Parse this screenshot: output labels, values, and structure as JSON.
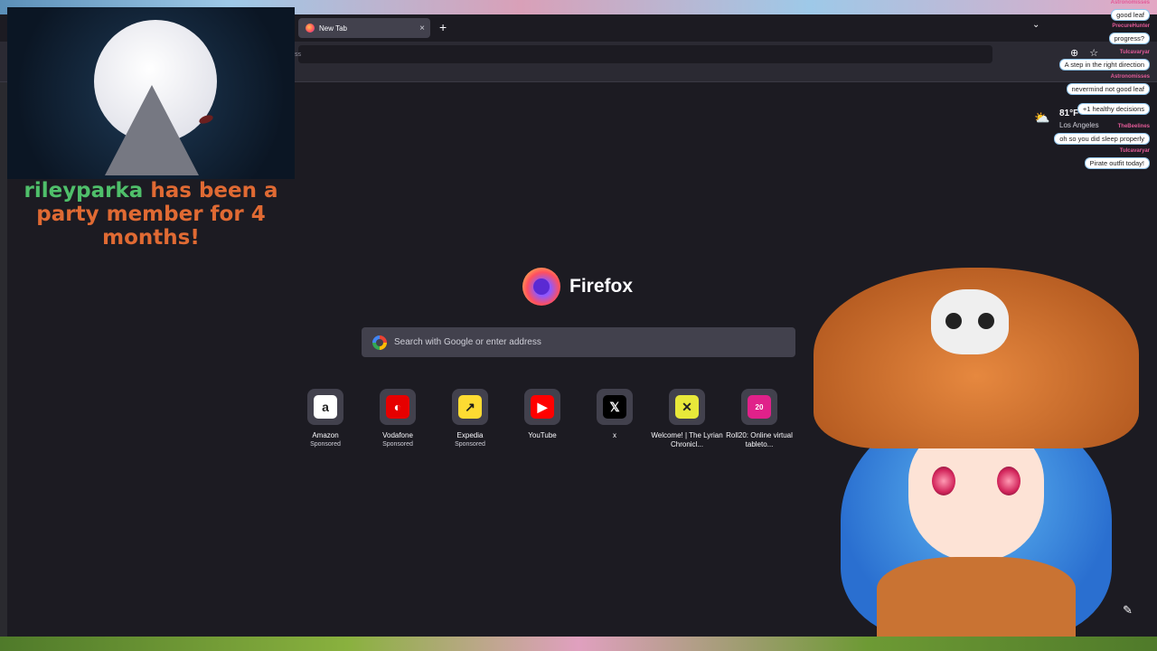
{
  "browser": {
    "tab": {
      "title": "New Tab"
    },
    "new_tab_symbol": "+",
    "tab_close_symbol": "×",
    "tab_list_symbol": "⌄",
    "urlbar_partial_text": "ss",
    "nav_icons": [
      "⊕",
      "☆"
    ]
  },
  "newtab": {
    "brand": "Firefox",
    "search_placeholder": "Search with Google or enter address",
    "tiles": [
      {
        "label": "Amazon",
        "sponsored": "Sponsored",
        "icon": "amazon-icon",
        "glyph": "a",
        "bg": "#ffffff",
        "fg": "#222222"
      },
      {
        "label": "Vodafone",
        "sponsored": "Sponsored",
        "icon": "vodafone-icon",
        "glyph": "◐",
        "bg": "#e60000",
        "fg": "#ffffff"
      },
      {
        "label": "Expedia",
        "sponsored": "Sponsored",
        "icon": "expedia-icon",
        "glyph": "↗",
        "bg": "#fddb32",
        "fg": "#1a1a1a"
      },
      {
        "label": "YouTube",
        "sponsored": "",
        "icon": "youtube-icon",
        "glyph": "▶",
        "bg": "#ff0000",
        "fg": "#ffffff"
      },
      {
        "label": "x",
        "sponsored": "",
        "icon": "x-icon",
        "glyph": "𝕏",
        "bg": "#000000",
        "fg": "#ffffff"
      },
      {
        "label": "Welcome! | The Lyrian Chronicl...",
        "sponsored": "",
        "icon": "lyrian-icon",
        "glyph": "✕",
        "bg": "#e8e83a",
        "fg": "#222222"
      },
      {
        "label": "Roll20: Online virtual tableto...",
        "sponsored": "",
        "icon": "roll20-icon",
        "glyph": "20",
        "bg": "#e0218a",
        "fg": "#ffffff"
      }
    ]
  },
  "weather": {
    "temp": "81°F",
    "city": "Los Angeles",
    "icon": "partly-cloudy-icon"
  },
  "stream_overlay": {
    "alert_user": "rileyparka",
    "alert_text": " has been a party member for 4 months!",
    "chat": [
      {
        "user": "Astronomisses",
        "text": "good leaf"
      },
      {
        "user": "PrecureHunter",
        "text": "progress?"
      },
      {
        "user": "Tulcavaryar",
        "text": "A step in the right direction"
      },
      {
        "user": "Astronomisses",
        "text": "nevermind not good leaf"
      },
      {
        "user": "",
        "text": "+1 healthy decisions"
      },
      {
        "user": "TheBeelines",
        "text": "oh so you did sleep properly"
      },
      {
        "user": "Tulcavaryar",
        "text": "Pirate outfit today!"
      }
    ]
  },
  "colors": {
    "accent": "#9059ff",
    "alert_orange": "#e06a33",
    "alert_green": "#4fbf6a"
  }
}
